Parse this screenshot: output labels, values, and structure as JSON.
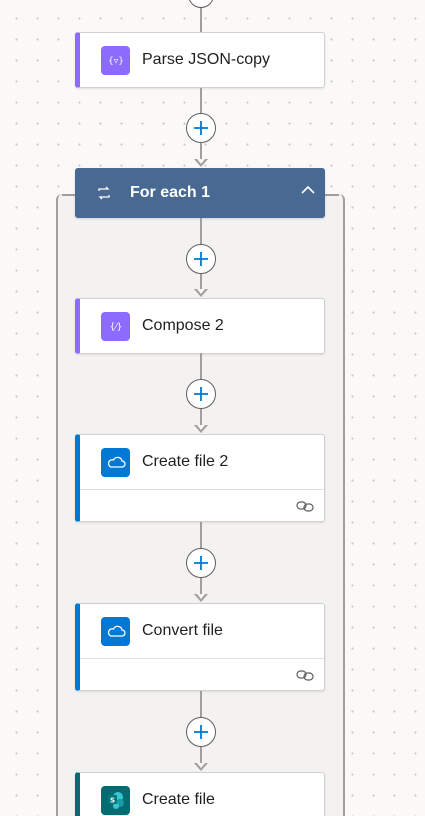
{
  "flow": {
    "parse_json": {
      "title": "Parse JSON-copy",
      "icon": "data-operation-icon",
      "accent": "#8c6cff"
    },
    "for_each": {
      "title": "For each 1",
      "icon": "loop-icon",
      "color": "#486991"
    },
    "compose": {
      "title": "Compose 2",
      "icon": "data-operation-icon",
      "accent": "#8c6cff"
    },
    "create_file_2": {
      "title": "Create file 2",
      "icon": "onedrive-icon",
      "accent": "#0078d4"
    },
    "convert_file": {
      "title": "Convert file",
      "icon": "onedrive-icon",
      "accent": "#0078d4"
    },
    "create_file": {
      "title": "Create file",
      "icon": "sharepoint-icon",
      "accent": "#036c70"
    }
  }
}
